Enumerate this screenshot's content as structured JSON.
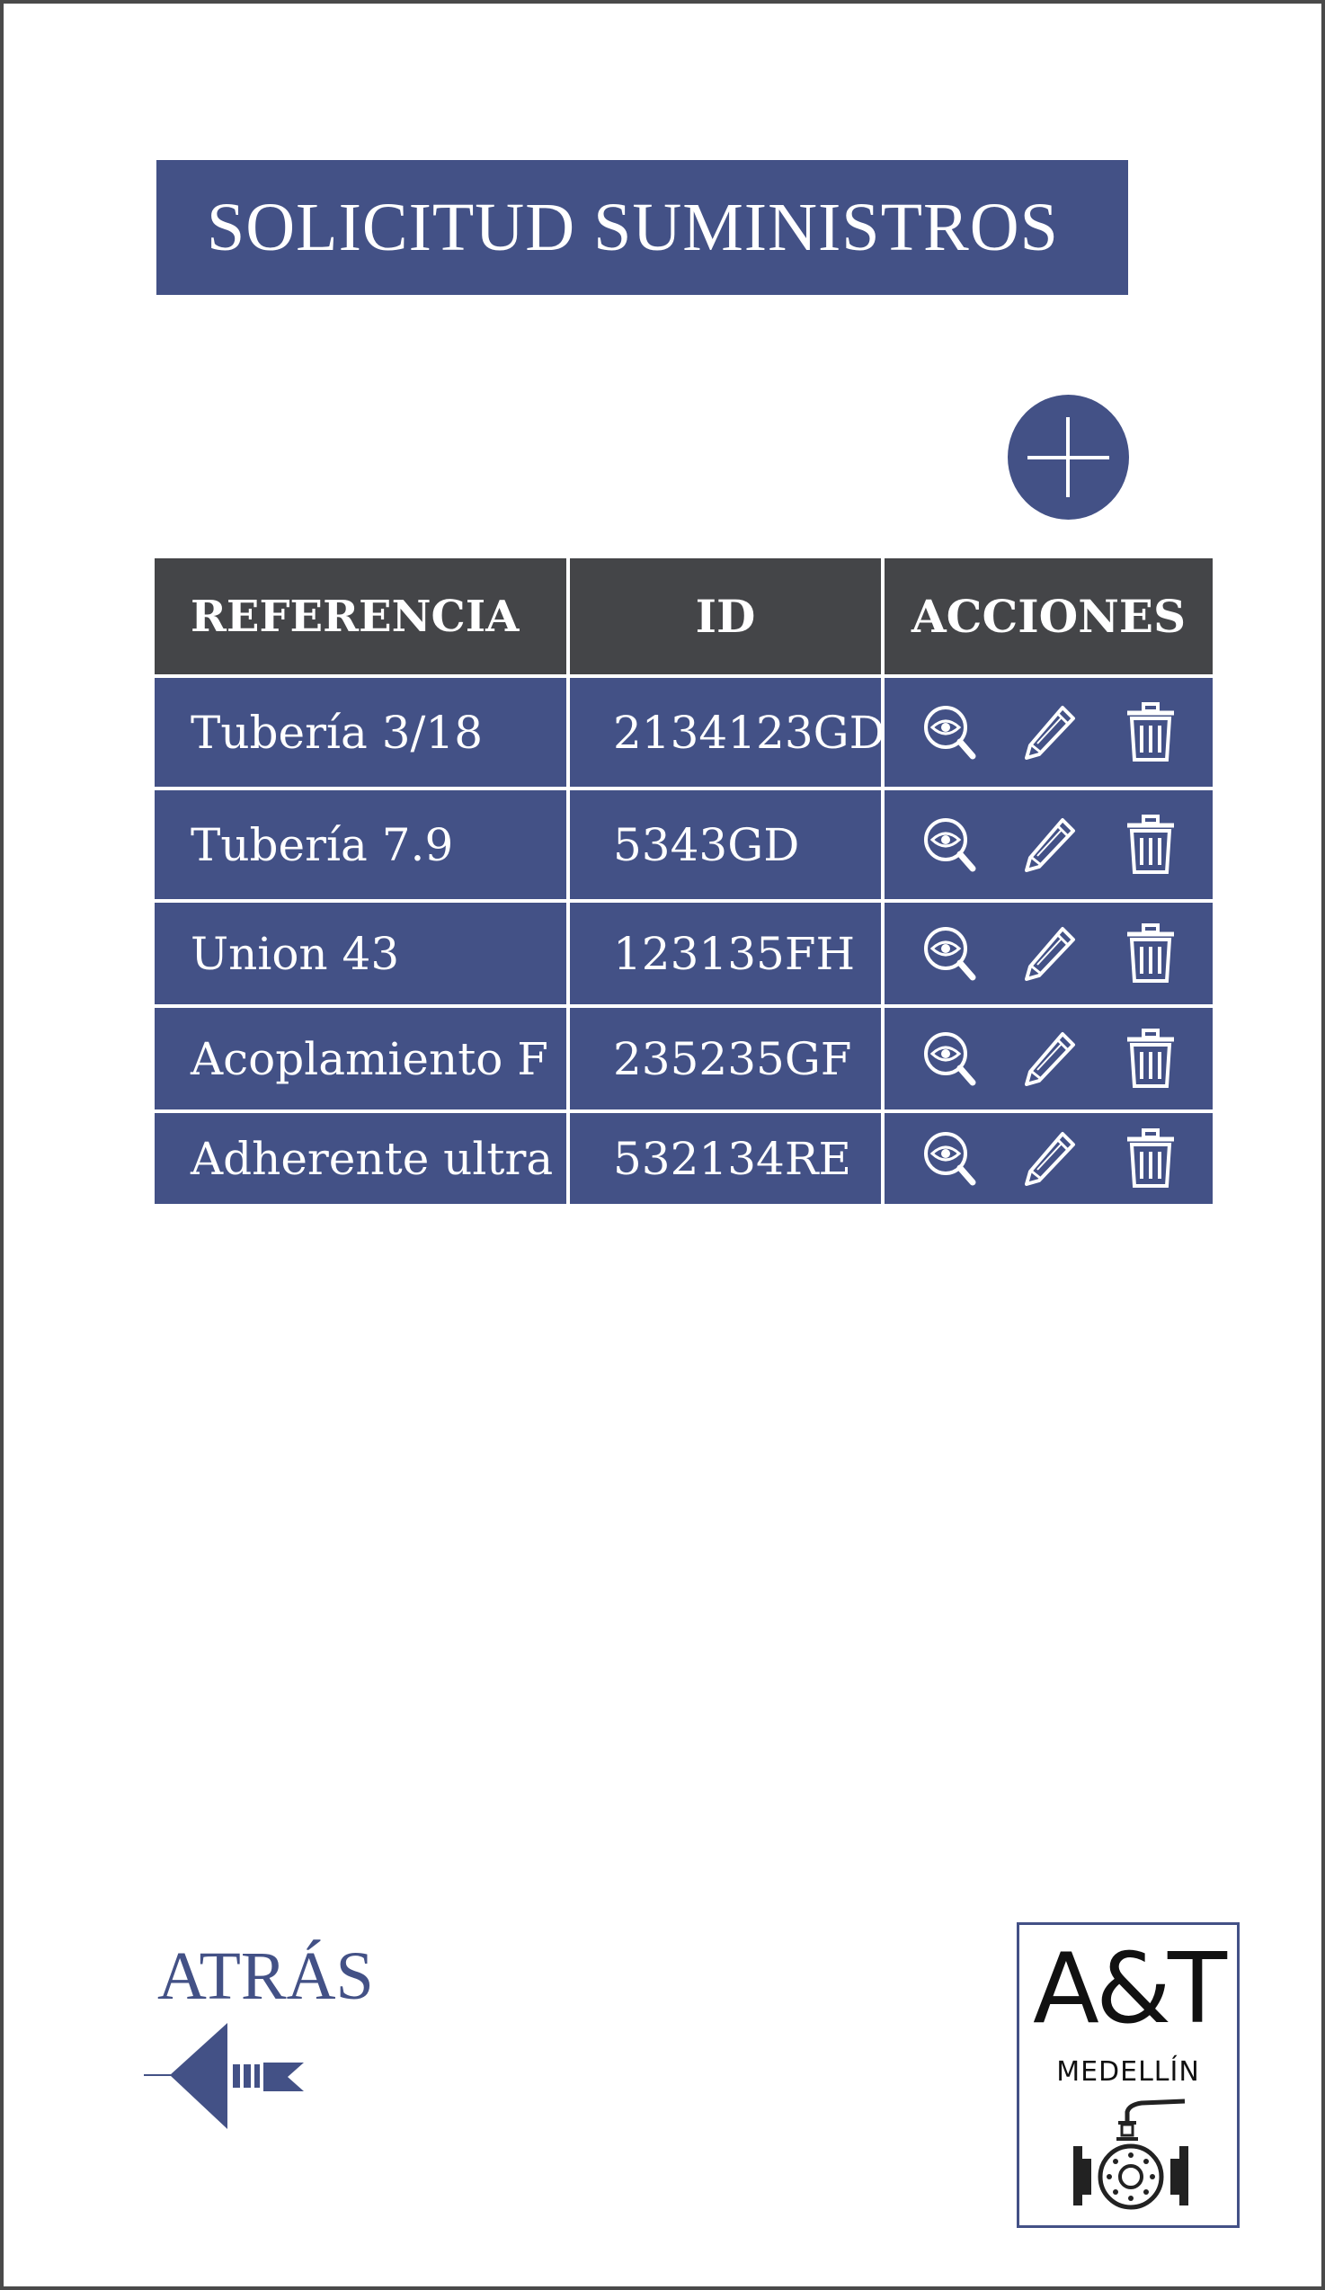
{
  "header": {
    "title": "SOLICITUD SUMINISTROS"
  },
  "actions": {
    "add_icon": "plus-icon"
  },
  "table": {
    "columns": [
      "REFERENCIA",
      "ID",
      "ACCIONES"
    ],
    "rows": [
      {
        "referencia": "Tubería 3/18",
        "id": "2134123GD"
      },
      {
        "referencia": "Tubería 7.9",
        "id": "5343GD"
      },
      {
        "referencia": "Union 43",
        "id": "123135FH"
      },
      {
        "referencia": "Acoplamiento F",
        "id": "235235GF"
      },
      {
        "referencia": "Adherente ultra",
        "id": "532134RE"
      }
    ],
    "row_icons": [
      "view-icon",
      "edit-icon",
      "delete-icon"
    ]
  },
  "footer": {
    "back_label": "ATRÁS",
    "back_icon": "arrow-left-icon",
    "logo_text": "A&T",
    "logo_subtext": "MEDELLÍN"
  },
  "colors": {
    "primary": "#435186",
    "header_dark": "#444548",
    "background": "#ffffff",
    "frame": "#4a4a4a"
  }
}
